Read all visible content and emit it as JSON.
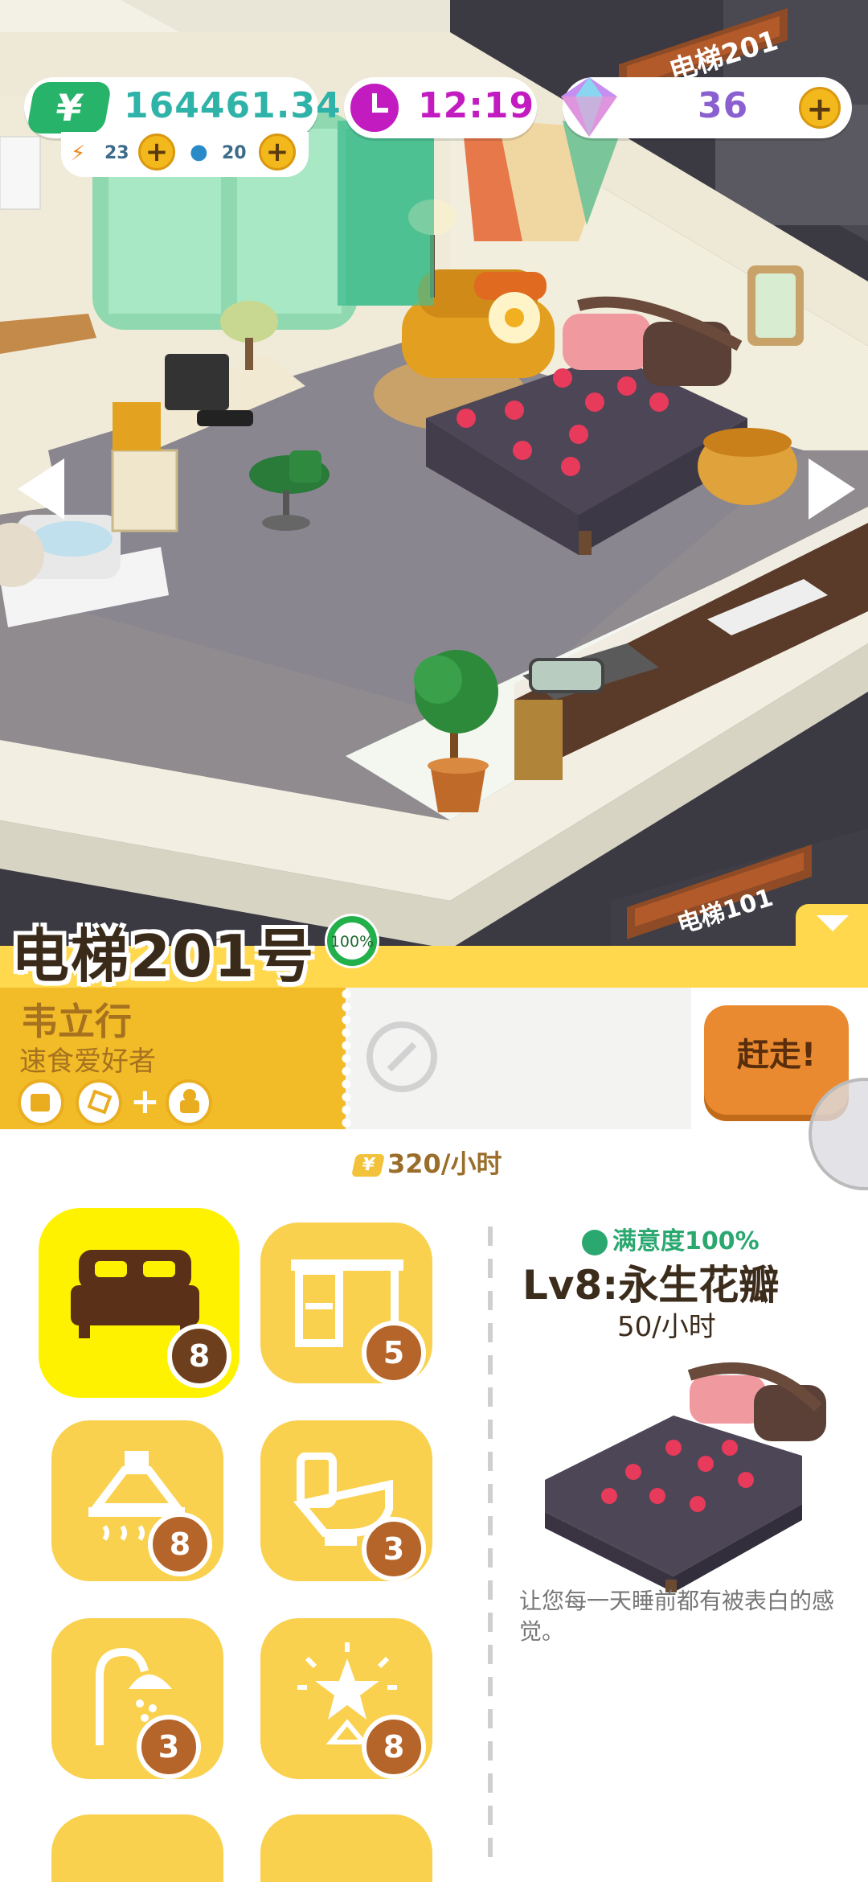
{
  "hud": {
    "money": "164461.34",
    "time": "12:19",
    "gems": "36",
    "energy": "23",
    "water": "20",
    "money_icon": "yuan-icon"
  },
  "scene": {
    "elevator_sign_top": "电梯201",
    "elevator_sign_bottom": "电梯101"
  },
  "room": {
    "title": "电梯201号",
    "progress": "100%",
    "progress_value": 1.0
  },
  "tenant": {
    "name": "韦立行",
    "tag": "速食爱好者",
    "plus": "+",
    "evict_label": "赶走!",
    "income": "320/小时",
    "income_icon": "yuan-icon",
    "trait_icons": [
      "mug-icon",
      "dice-icon",
      "plant-icon"
    ]
  },
  "categories": [
    {
      "icon": "bed-icon",
      "count": "8",
      "selected": true
    },
    {
      "icon": "desk-icon",
      "count": "5",
      "selected": false
    },
    {
      "icon": "range-hood-icon",
      "count": "8",
      "selected": false
    },
    {
      "icon": "toilet-icon",
      "count": "3",
      "selected": false
    },
    {
      "icon": "shower-icon",
      "count": "3",
      "selected": false
    },
    {
      "icon": "decor-star-icon",
      "count": "8",
      "selected": false
    }
  ],
  "detail": {
    "satisfaction": "满意度100%",
    "title": "Lv8:永生花瓣",
    "rate": "50/小时",
    "description": "让您每一天睡前都有被表白的感觉。"
  },
  "colors": {
    "accent_yellow": "#ffd84e",
    "tenant_orange": "#f2bc28",
    "evict_button": "#e98a30",
    "money_teal": "#2fb3a8",
    "gem_purple": "#8a5fd0",
    "clock_magenta": "#c21cc0",
    "satisfaction_green": "#2aa870"
  }
}
